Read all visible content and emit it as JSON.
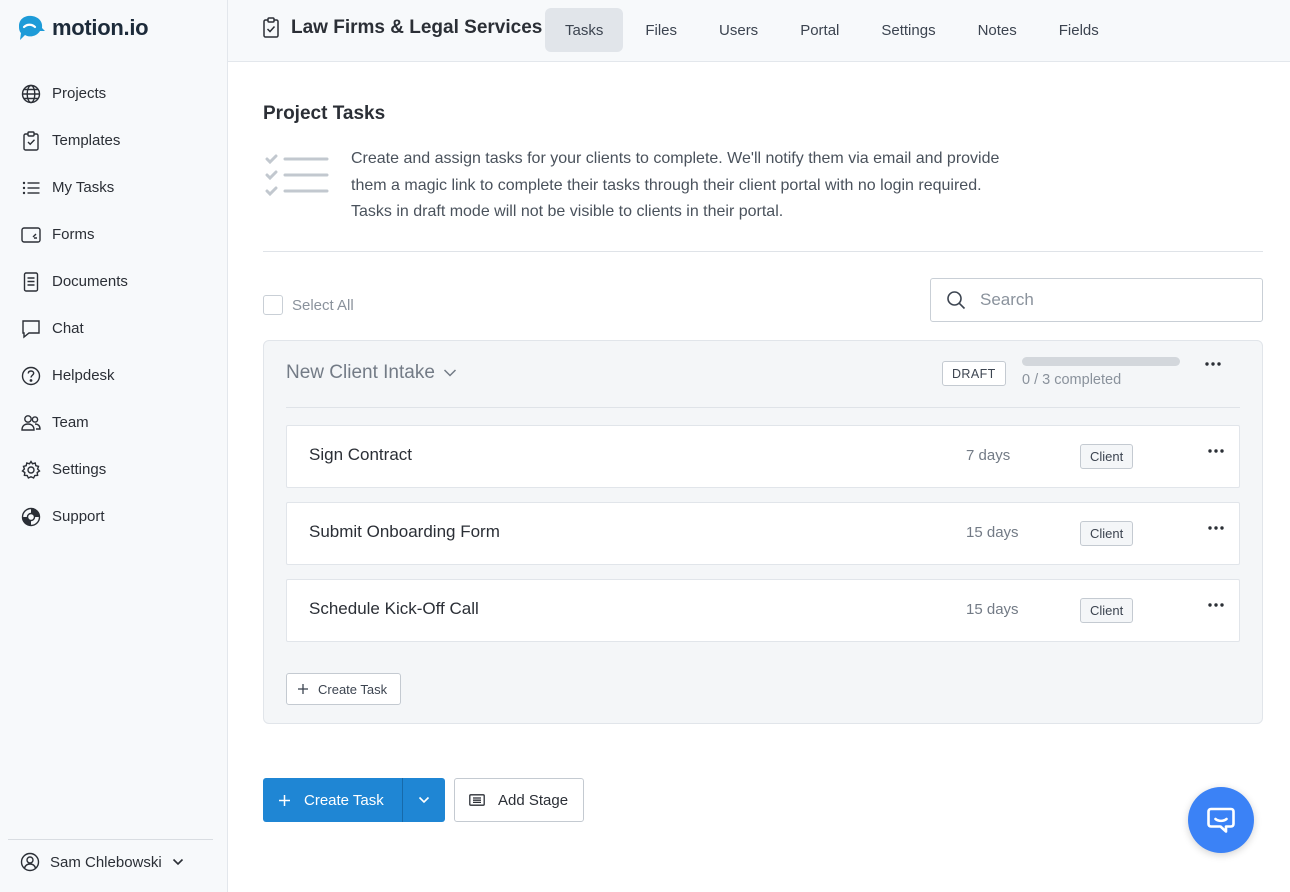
{
  "brand": {
    "name": "motion.io",
    "color": "#1d9bd8"
  },
  "sidebar": {
    "items": [
      {
        "label": "Projects",
        "icon": "globe-icon"
      },
      {
        "label": "Templates",
        "icon": "clipboard-icon"
      },
      {
        "label": "My Tasks",
        "icon": "list-icon"
      },
      {
        "label": "Forms",
        "icon": "form-icon"
      },
      {
        "label": "Documents",
        "icon": "document-icon"
      },
      {
        "label": "Chat",
        "icon": "chat-icon"
      },
      {
        "label": "Helpdesk",
        "icon": "question-icon"
      },
      {
        "label": "Team",
        "icon": "team-icon"
      },
      {
        "label": "Settings",
        "icon": "gear-icon"
      },
      {
        "label": "Support",
        "icon": "lifebuoy-icon"
      }
    ],
    "user": {
      "name": "Sam Chlebowski"
    }
  },
  "header": {
    "project_title": "Law Firms & Legal Services",
    "tabs": [
      {
        "label": "Tasks",
        "active": true
      },
      {
        "label": "Files",
        "active": false
      },
      {
        "label": "Users",
        "active": false
      },
      {
        "label": "Portal",
        "active": false
      },
      {
        "label": "Settings",
        "active": false
      },
      {
        "label": "Notes",
        "active": false
      },
      {
        "label": "Fields",
        "active": false
      }
    ]
  },
  "main": {
    "title": "Project Tasks",
    "description": "Create and assign tasks for your clients to complete. We'll notify them via email and provide them a magic link to complete their tasks through their client portal with no login required. Tasks in draft mode will not be visible to clients in their portal.",
    "select_all_label": "Select All",
    "search_placeholder": "Search",
    "stage": {
      "name": "New Client Intake",
      "status": "DRAFT",
      "progress_text": "0 / 3 completed",
      "progress_fraction": 0,
      "tasks": [
        {
          "name": "Sign Contract",
          "due": "7 days",
          "assignee": "Client"
        },
        {
          "name": "Submit Onboarding Form",
          "due": "15 days",
          "assignee": "Client"
        },
        {
          "name": "Schedule Kick-Off Call",
          "due": "15 days",
          "assignee": "Client"
        }
      ],
      "create_task_label": "Create Task"
    },
    "create_task_label": "Create Task",
    "add_stage_label": "Add Stage"
  },
  "colors": {
    "primary": "#1f86d4",
    "chat_fab": "#3b82f6"
  }
}
